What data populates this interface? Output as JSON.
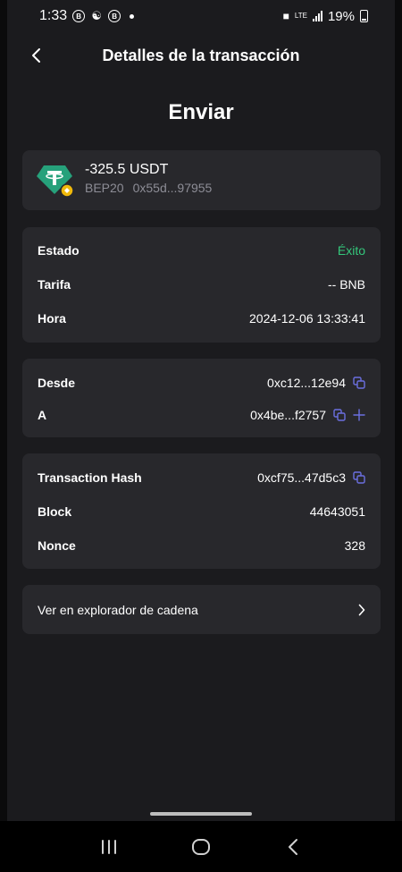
{
  "status_bar": {
    "time": "1:33",
    "battery": "19%",
    "network": "LTE"
  },
  "header": {
    "title": "Detalles de la transacción"
  },
  "page_title": "Enviar",
  "asset": {
    "amount": "-325.5 USDT",
    "network": "BEP20",
    "address": "0x55d...97955",
    "icon": "tether-icon"
  },
  "details": {
    "estado_label": "Estado",
    "estado_value": "Éxito",
    "tarifa_label": "Tarifa",
    "tarifa_value": "-- BNB",
    "hora_label": "Hora",
    "hora_value": "2024-12-06 13:33:41"
  },
  "addresses": {
    "desde_label": "Desde",
    "desde_value": "0xc12...12e94",
    "a_label": "A",
    "a_value": "0x4be...f2757"
  },
  "chain": {
    "hash_label": "Transaction Hash",
    "hash_value": "0xcf75...47d5c3",
    "block_label": "Block",
    "block_value": "44643051",
    "nonce_label": "Nonce",
    "nonce_value": "328"
  },
  "explorer": {
    "label": "Ver en explorador de cadena"
  },
  "colors": {
    "background": "#1b1b1e",
    "card": "#28282c",
    "success": "#34c77b",
    "accent": "#6b6fe0"
  }
}
